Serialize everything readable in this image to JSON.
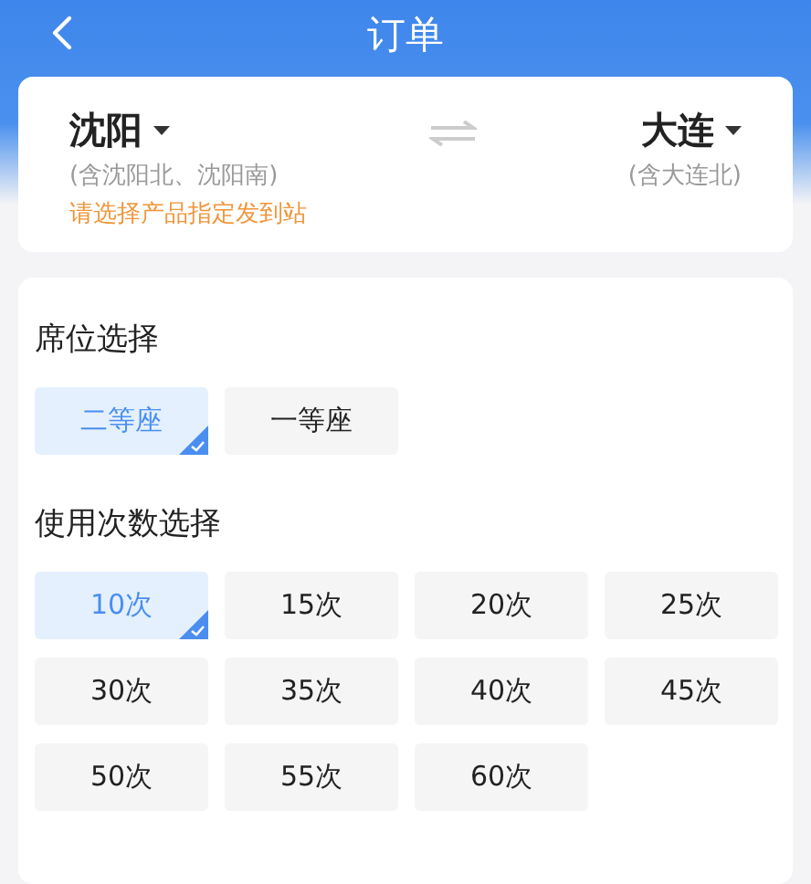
{
  "header": {
    "title": "订单"
  },
  "route": {
    "from": {
      "city": "沈阳",
      "note": "(含沈阳北、沈阳南)"
    },
    "to": {
      "city": "大连",
      "note": "(含大连北)"
    },
    "hint": "请选择产品指定发到站"
  },
  "seat_section": {
    "title": "席位选择",
    "options": [
      {
        "label": "二等座",
        "selected": true
      },
      {
        "label": "一等座",
        "selected": false
      }
    ]
  },
  "count_section": {
    "title": "使用次数选择",
    "options": [
      {
        "label": "10次",
        "selected": true
      },
      {
        "label": "15次",
        "selected": false
      },
      {
        "label": "20次",
        "selected": false
      },
      {
        "label": "25次",
        "selected": false
      },
      {
        "label": "30次",
        "selected": false
      },
      {
        "label": "35次",
        "selected": false
      },
      {
        "label": "40次",
        "selected": false
      },
      {
        "label": "45次",
        "selected": false
      },
      {
        "label": "50次",
        "selected": false
      },
      {
        "label": "55次",
        "selected": false
      },
      {
        "label": "60次",
        "selected": false
      }
    ]
  }
}
